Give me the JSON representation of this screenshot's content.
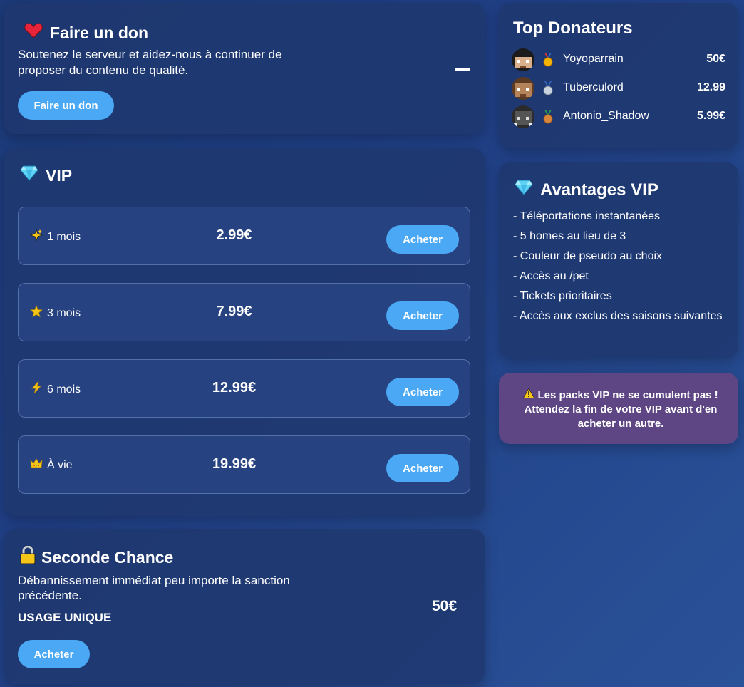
{
  "donate": {
    "title": "Faire un don",
    "description": "Soutenez le serveur et aidez-nous à continuer de proposer du contenu de qualité.",
    "button_label": "Faire un don"
  },
  "vip": {
    "title": "VIP",
    "packs": [
      {
        "label": "1 mois",
        "price": "2.99€",
        "button_label": "Acheter",
        "icon": "sparkles-icon"
      },
      {
        "label": "3 mois",
        "price": "7.99€",
        "button_label": "Acheter",
        "icon": "star-icon"
      },
      {
        "label": "6 mois",
        "price": "12.99€",
        "button_label": "Acheter",
        "icon": "lightning-icon"
      },
      {
        "label": "À vie",
        "price": "19.99€",
        "button_label": "Acheter",
        "icon": "crown-icon"
      }
    ]
  },
  "second_chance": {
    "title": "Seconde Chance",
    "description": "Débannissement immédiat peu importe la sanction précédente.",
    "usage": "USAGE UNIQUE",
    "price": "50€",
    "button_label": "Acheter"
  },
  "top_donors": {
    "title": "Top Donateurs",
    "donors": [
      {
        "name": "Yoyoparrain",
        "amount": "50€",
        "medal": "gold-medal-icon"
      },
      {
        "name": "Tuberculord",
        "amount": "12.99",
        "medal": "silver-medal-icon"
      },
      {
        "name": "Antonio_Shadow",
        "amount": "5.99€",
        "medal": "bronze-medal-icon"
      }
    ]
  },
  "advantages": {
    "title": "Avantages VIP",
    "items": [
      "- Téléportations instantanées",
      "- 5 homes au lieu de 3",
      "- Couleur de pseudo au choix",
      "- Accès au /pet",
      "- Tickets prioritaires",
      "- Accès aux exclus des saisons suivantes"
    ]
  },
  "warning": {
    "text": "Les packs VIP ne se cumulent pas ! Attendez la fin de votre VIP avant d'en acheter un autre."
  },
  "colors": {
    "accent_button": "#4aa8f5",
    "warning_bg": "#64468a"
  }
}
